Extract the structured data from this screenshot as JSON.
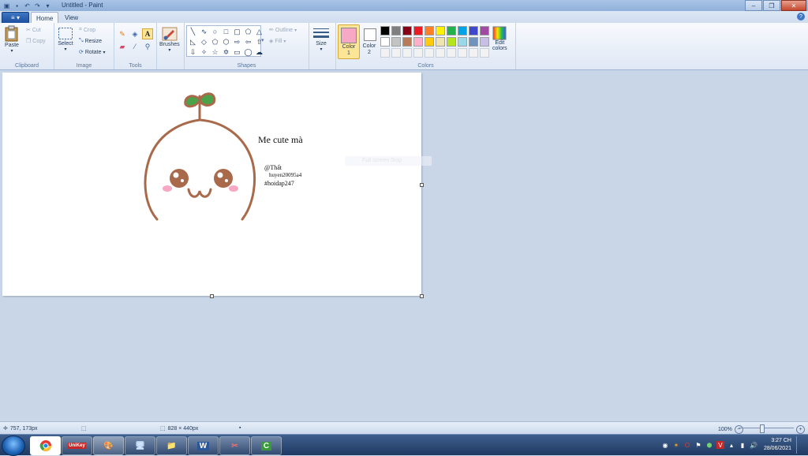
{
  "window": {
    "title": "Untitled - Paint"
  },
  "tabs": {
    "home": "Home",
    "view": "View"
  },
  "ribbon": {
    "clipboard": {
      "paste": "Paste",
      "cut": "Cut",
      "copy": "Copy",
      "label": "Clipboard"
    },
    "image": {
      "select": "Select",
      "crop": "Crop",
      "resize": "Resize",
      "rotate": "Rotate",
      "label": "Image"
    },
    "tools": {
      "label": "Tools"
    },
    "brushes": {
      "label": "Brushes"
    },
    "shapes": {
      "outline": "Outline",
      "fill": "Fill",
      "label": "Shapes"
    },
    "size": {
      "label": "Size"
    },
    "colors": {
      "color1": "Color",
      "color1_num": "1",
      "color2": "Color",
      "color2_num": "2",
      "edit": "Edit",
      "edit2": "colors",
      "label": "Colors",
      "color1_value": "#f7a8c4",
      "color2_value": "#ffffff",
      "palette": [
        "#000000",
        "#7f7f7f",
        "#880015",
        "#ed1c24",
        "#ff7f27",
        "#fff200",
        "#22b14c",
        "#00a2e8",
        "#3f48cc",
        "#a349a4",
        "#ffffff",
        "#c3c3c3",
        "#b97a57",
        "#ffaec9",
        "#ffc90e",
        "#efe4b0",
        "#b5e61d",
        "#99d9ea",
        "#7092be",
        "#c8bfe7",
        "#f2f2f2",
        "#f2f2f2",
        "#f2f2f2",
        "#f2f2f2",
        "#f2f2f2",
        "#f2f2f2",
        "#f2f2f2",
        "#f2f2f2",
        "#f2f2f2",
        "#f2f2f2"
      ]
    }
  },
  "canvas": {
    "heading": "Me cute mà",
    "handle_line1": "@Thất",
    "handle_line2": "huyen20095a4",
    "hashtag": "#hoidap247",
    "faint_text": "Full screen Snip",
    "drawing_color": "#a86a4a"
  },
  "status": {
    "cursor": "757, 173px",
    "dimensions": "828 × 440px",
    "zoom": "100%"
  },
  "taskbar": {
    "time": "3:27 CH",
    "date": "28/06/2021"
  }
}
